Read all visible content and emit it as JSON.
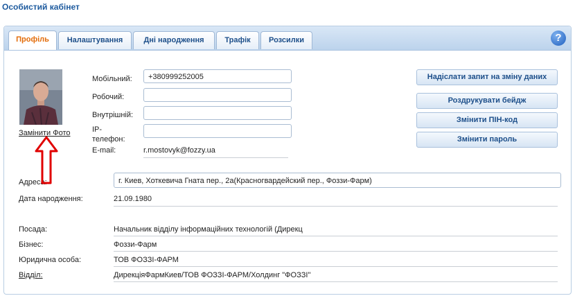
{
  "page": {
    "title": "Особистий кабінет"
  },
  "tabs": [
    "Профіль",
    "Налаштування",
    "Дні народження",
    "Трафік",
    "Розсилки"
  ],
  "help_label": "?",
  "profile": {
    "change_photo": "Замінити Фото",
    "contacts": {
      "mobile_label": "Мобільний:",
      "mobile_value": "+380999252005",
      "work_label": "Робочий:",
      "work_value": "",
      "internal_label": "Внутрішній:",
      "internal_value": "",
      "ip_label_1": "IP-",
      "ip_label_2": "телефон:",
      "ip_value": "",
      "email_label": "E-mail:",
      "email_value": "r.mostovyk@fozzy.ua"
    },
    "address_label": "Адреса:",
    "address_value": "г. Киев, Хоткевича Гната пер., 2а(Красногвардейский пер., Фоззи-Фарм)",
    "birth_label": "Дата народження:",
    "birth_value": "21.09.1980",
    "position_label": "Посада:",
    "position_value": "Начальник відділу інформаційних технологій (Дирекц",
    "business_label": "Бізнес:",
    "business_value": "Фоззи-Фарм",
    "legal_label": "Юридична особа:",
    "legal_value": "ТОВ ФОЗЗІ-ФАРМ",
    "department_label": "Відділ:",
    "department_value": "ДирекціяФармКиев/ТОВ ФОЗЗІ-ФАРМ/Холдинг \"ФОЗЗІ\""
  },
  "actions": {
    "request_change": "Надіслати запит на зміну даних",
    "print_badge": "Роздрукувати бейдж",
    "change_pin": "Змінити ПІН-код",
    "change_password": "Змінити пароль"
  },
  "colors": {
    "title": "#1d5a9e",
    "active_tab": "#e36c09",
    "annotation_arrow": "#e00000"
  }
}
